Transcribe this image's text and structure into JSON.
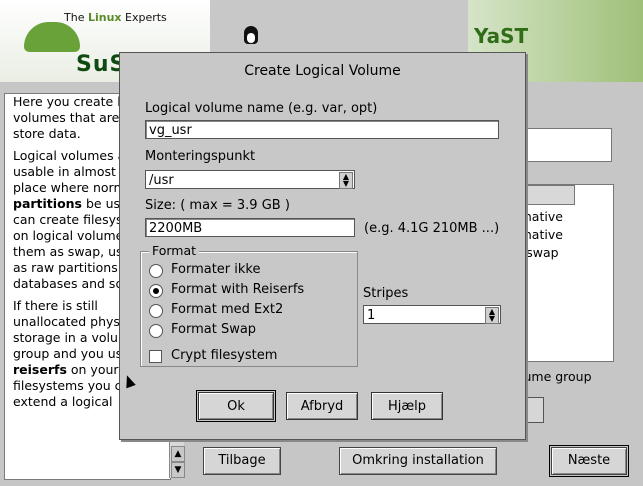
{
  "header": {
    "tagline_prefix": "The ",
    "tagline_brand": "Linux",
    "tagline_suffix": " Experts",
    "logo_word": "SuS",
    "yast_logo": "YaST"
  },
  "help": {
    "paragraphs": [
      "Here you create logical volumes that are used to store data.",
      "Logical volumes are usable in almost every place where normal",
      "be used. You can create filesystems on logical volumes, use them as swap, use them as raw partitions for databases and so on.",
      "If there is still unallocated physical storage in a volume group and you use",
      "on your filesystems you can extend a logical"
    ],
    "bold_disk": "disk partitions",
    "bold_reiser": "reiserfs",
    "scroll_up": "▲",
    "scroll_down": "▼"
  },
  "background": {
    "list_header": "e",
    "list_rows": [
      "t native",
      "t native",
      "k swap"
    ],
    "volume_group_text": "lume group",
    "buttons": {
      "back": "Tilbage",
      "about": "Omkring installation",
      "next": "Næste"
    }
  },
  "dialog": {
    "title": "Create Logical Volume",
    "lv_name_label": "Logical volume name (e.g. var, opt)",
    "lv_name_value": "vg_usr",
    "mount_label": "Monteringspunkt",
    "mount_value": "/usr",
    "size_label": "Size:  ( max =   3.9 GB )",
    "size_value": "2200MB",
    "size_hint": "(e.g. 4.1G  210MB ...)",
    "format_group": "Format",
    "format_options": [
      "Formater ikke",
      "Format with Reiserfs",
      "Format med Ext2",
      "Format Swap"
    ],
    "selected_format": "Format with Reiserfs",
    "crypt_label": "Crypt filesystem",
    "crypt_checked": false,
    "stripes_label": "Stripes",
    "stripes_value": "1",
    "buttons": {
      "ok": "Ok",
      "cancel": "Afbryd",
      "help": "Hjælp"
    }
  },
  "colors": {
    "dialog_bg": "#c8c8c8",
    "brand_green": "#5b8a2b"
  }
}
